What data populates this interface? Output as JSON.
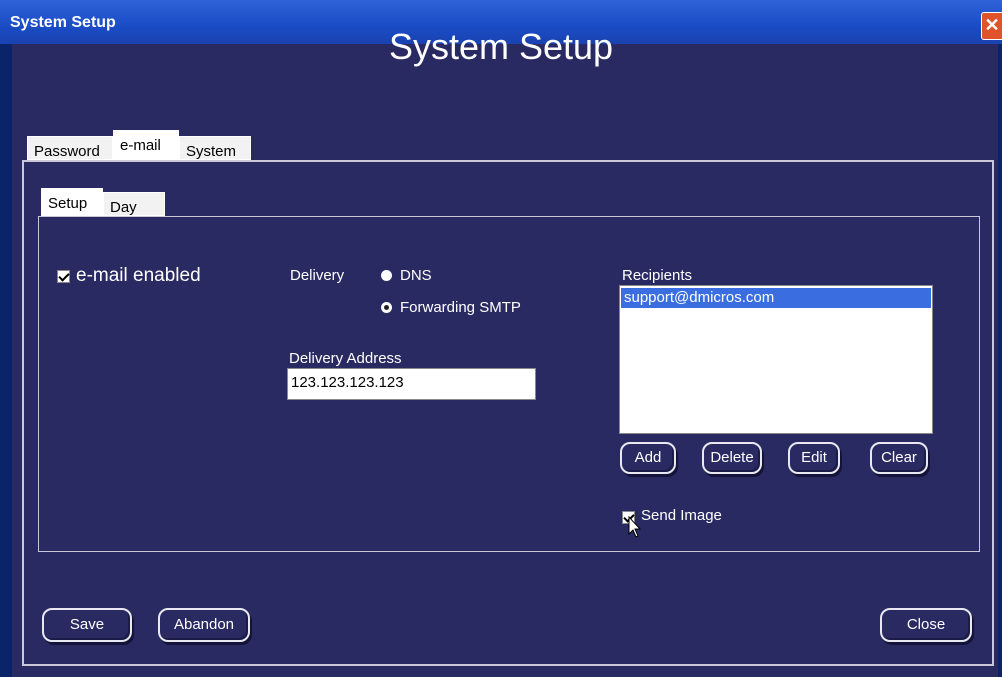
{
  "window": {
    "title": "System Setup",
    "close_glyph": "✕"
  },
  "heading": "System Setup",
  "main_tabs": [
    {
      "label": "Password"
    },
    {
      "label": "e-mail"
    },
    {
      "label": "System"
    }
  ],
  "sub_tabs": [
    {
      "label": "Setup"
    },
    {
      "label": "Day"
    }
  ],
  "email_enabled": {
    "label": "e-mail enabled",
    "checked": true
  },
  "delivery": {
    "label": "Delivery",
    "options": [
      {
        "label": "DNS",
        "selected": false
      },
      {
        "label": "Forwarding SMTP",
        "selected": true
      }
    ]
  },
  "delivery_address": {
    "label": "Delivery Address",
    "value": "123.123.123.123"
  },
  "recipients": {
    "label": "Recipients",
    "items": [
      "support@dmicros.com"
    ],
    "buttons": {
      "add": "Add",
      "delete": "Delete",
      "edit": "Edit",
      "clear": "Clear"
    }
  },
  "send_image": {
    "label": "Send Image",
    "checked": true
  },
  "footer": {
    "save": "Save",
    "abandon": "Abandon",
    "close": "Close"
  },
  "colors": {
    "background": "#2a2a63",
    "titlebar": "#1a4cc6",
    "selection": "#3a6ee0"
  }
}
